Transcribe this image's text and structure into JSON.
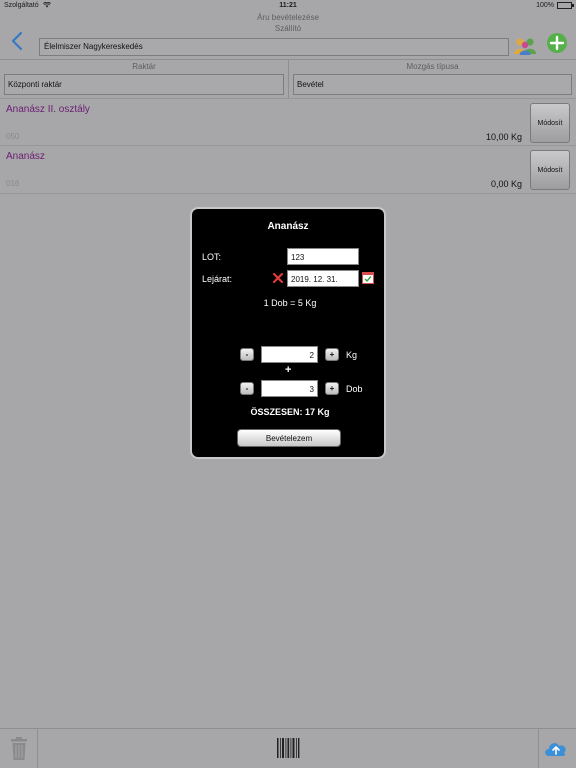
{
  "status": {
    "carrier": "Szolgáltató",
    "time": "11:21",
    "battery": "100%",
    "battery_level": 1.0
  },
  "header": {
    "title": "Áru bevételezése",
    "supplier_label": "Szállító",
    "supplier_value": "Élelmiszer Nagykereskedés"
  },
  "filters": {
    "warehouse_label": "Raktár",
    "warehouse_value": "Központi raktár",
    "movement_label": "Mozgás típusa",
    "movement_value": "Bevétel"
  },
  "items": [
    {
      "name": "Ananász II. osztály",
      "code": "050",
      "quantity": "10,00 Kg",
      "button": "Módosít"
    },
    {
      "name": "Ananász",
      "code": "016",
      "quantity": "0,00 Kg",
      "button": "Módosít"
    }
  ],
  "modal": {
    "title": "Ananász",
    "lot_label": "LOT:",
    "lot_value": "123",
    "expiry_label": "Lejárat:",
    "expiry_value": "2019. 12. 31.",
    "conversion": "1 Dob = 5 Kg",
    "minus": "-",
    "plus": "+",
    "kg_value": "2",
    "kg_unit": "Kg",
    "plus_sign": "+",
    "dob_value": "3",
    "dob_unit": "Dob",
    "total": "ÖSSZESEN: 17 Kg",
    "submit": "Bevételezem"
  },
  "icons": {
    "back": "chevron-left-icon",
    "people": "people-icon",
    "add": "plus-circle-icon",
    "clear": "close-icon",
    "calendar": "calendar-check-icon",
    "trash": "trash-icon",
    "barcode": "barcode-icon",
    "upload": "cloud-upload-icon"
  },
  "colors": {
    "background": "#a7a7a9",
    "item_name": "#6a1d72",
    "back_accent": "#3478c6",
    "add_green": "#55b04a",
    "clear_red": "#e03b3b",
    "calendar_red": "#d94c4c",
    "calendar_check": "#3fa244"
  }
}
